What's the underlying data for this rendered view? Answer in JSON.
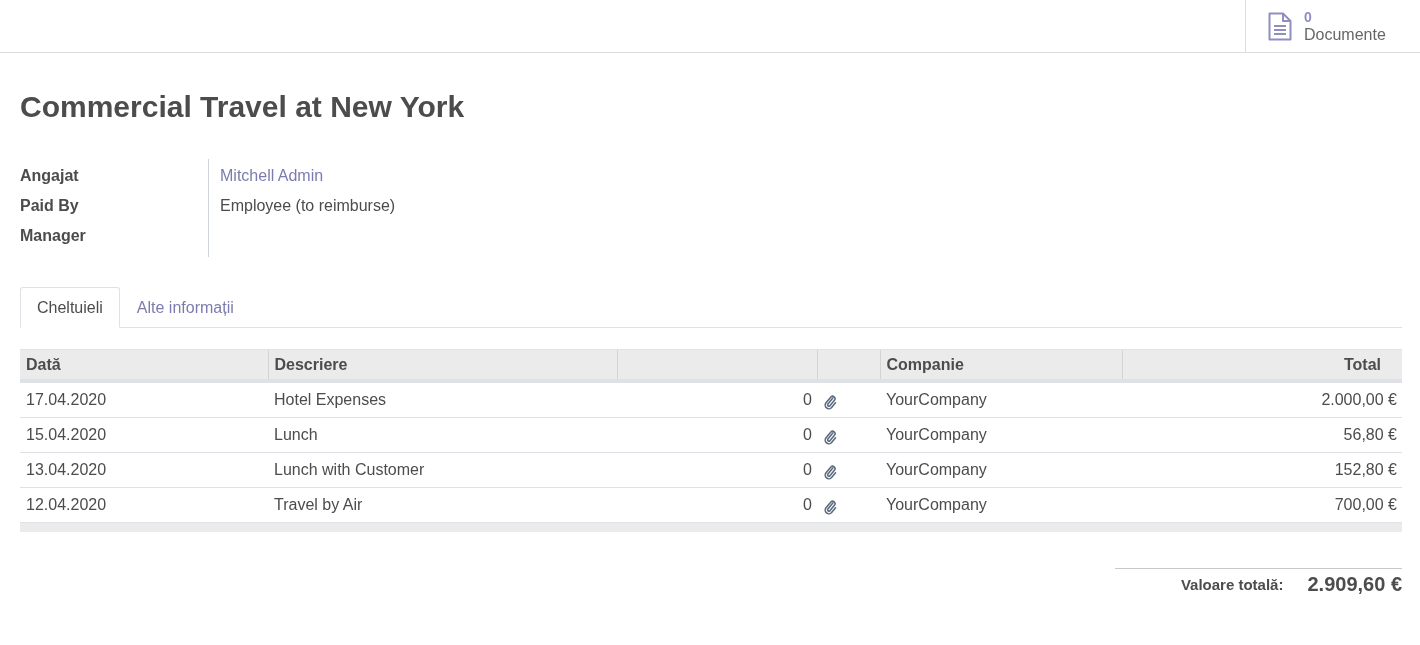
{
  "top_bar": {
    "documents": {
      "count": "0",
      "label": "Documente"
    }
  },
  "title": "Commercial Travel at New York",
  "fields": [
    {
      "label": "Angajat",
      "value": "Mitchell Admin",
      "kind": "link"
    },
    {
      "label": "Paid By",
      "value": "Employee (to reimburse)",
      "kind": "text"
    },
    {
      "label": "Manager"
    }
  ],
  "tabs": [
    {
      "label": "Cheltuieli",
      "selected": true
    },
    {
      "label": "Alte informații",
      "selected": false
    }
  ],
  "table": {
    "columns": [
      {
        "kind": "text",
        "label": "Dată"
      },
      {
        "kind": "text",
        "label": "Descriere"
      },
      {
        "kind": "number"
      },
      {
        "kind": "icon"
      },
      {
        "kind": "text",
        "label": "Companie"
      },
      {
        "kind": "number",
        "label": "Total"
      }
    ],
    "rows": [
      {
        "cells": [
          "17.04.2020",
          "Hotel Expenses",
          "0",
          "",
          "YourCompany",
          "2.000,00 €"
        ]
      },
      {
        "cells": [
          "15.04.2020",
          "Lunch",
          "0",
          "",
          "YourCompany",
          "56,80 €"
        ]
      },
      {
        "cells": [
          "13.04.2020",
          "Lunch with Customer",
          "0",
          "",
          "YourCompany",
          "152,80 €"
        ]
      },
      {
        "cells": [
          "12.04.2020",
          "Travel by Air",
          "0",
          "",
          "YourCompany",
          "700,00 €"
        ]
      }
    ]
  },
  "total": {
    "label": "Valoare totală:",
    "value": "2.909,60 €"
  }
}
